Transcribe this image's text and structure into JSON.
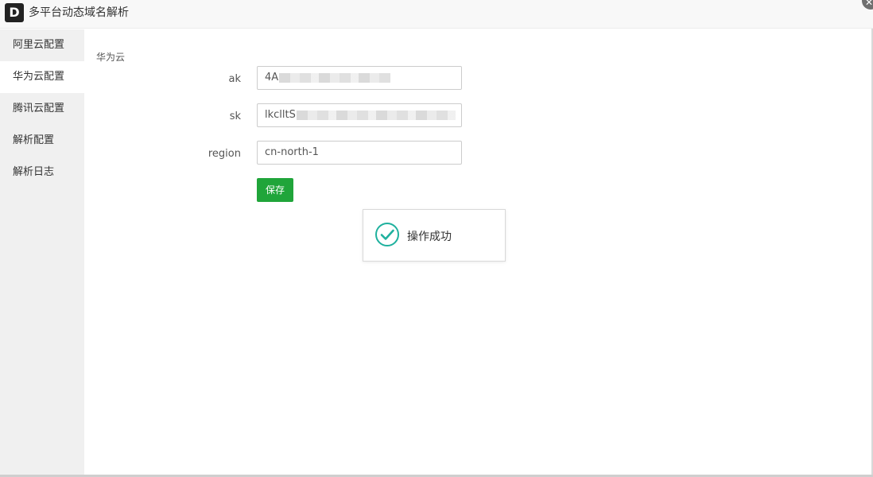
{
  "window": {
    "logo_letter": "D",
    "title": "多平台动态域名解析"
  },
  "sidebar": {
    "items": [
      {
        "label": "阿里云配置",
        "active": false
      },
      {
        "label": "华为云配置",
        "active": true
      },
      {
        "label": "腾讯云配置",
        "active": false
      },
      {
        "label": "解析配置",
        "active": false
      },
      {
        "label": "解析日志",
        "active": false
      }
    ]
  },
  "main": {
    "section_title": "华为云",
    "fields": {
      "ak": {
        "label": "ak",
        "visible_value": "4A"
      },
      "sk": {
        "label": "sk",
        "visible_value": "lkclltS"
      },
      "region": {
        "label": "region",
        "value": "cn-north-1"
      }
    },
    "save_label": "保存"
  },
  "toast": {
    "message": "操作成功",
    "icon": "check-circle-icon",
    "color": "#1fb19e"
  },
  "colors": {
    "accent": "#20a53a",
    "sidebar_bg": "#f0f0f0"
  }
}
